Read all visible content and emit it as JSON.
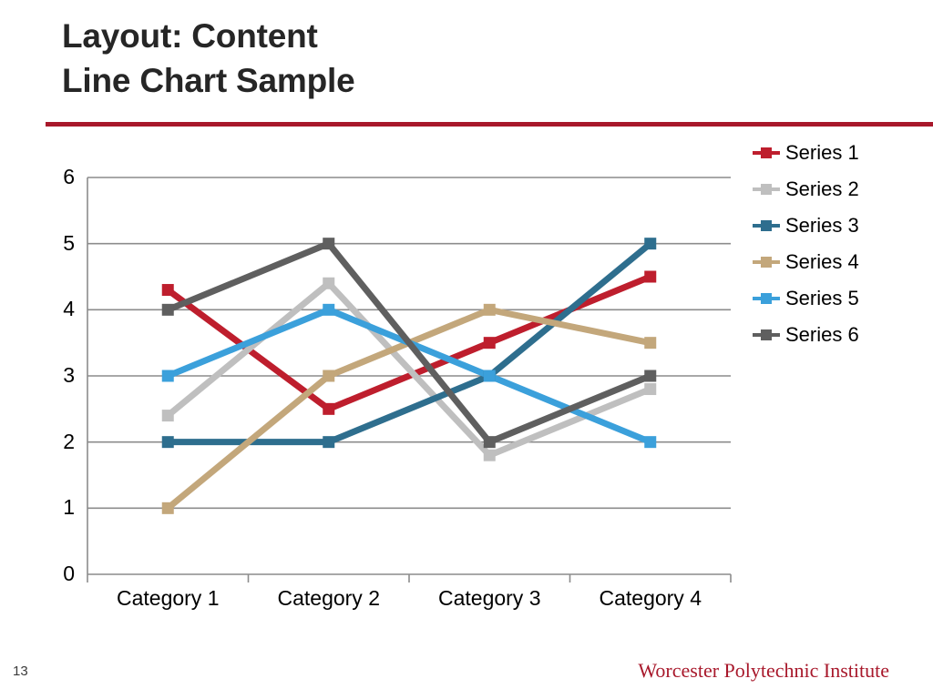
{
  "slide": {
    "title_line1": "Layout: Content",
    "title_line2": "Line Chart Sample",
    "rule_color": "#A8182B",
    "slide_number": "13",
    "footer_brand": "Worcester Polytechnic Institute"
  },
  "legend": {
    "position": "right",
    "items": [
      {
        "label": "Series 1",
        "color": "#BE1E2D"
      },
      {
        "label": "Series 2",
        "color": "#BFBFBF"
      },
      {
        "label": "Series 3",
        "color": "#2E6E8E"
      },
      {
        "label": "Series 4",
        "color": "#C3A77B"
      },
      {
        "label": "Series 5",
        "color": "#3BA0DB"
      },
      {
        "label": "Series 6",
        "color": "#5F5F5F"
      }
    ]
  },
  "chart_data": {
    "type": "line",
    "title": "Line Chart Sample",
    "xlabel": "",
    "ylabel": "",
    "categories": [
      "Category 1",
      "Category 2",
      "Category 3",
      "Category 4"
    ],
    "ylim": [
      0,
      6
    ],
    "yticks": [
      0,
      1,
      2,
      3,
      4,
      5,
      6
    ],
    "ytick_labels": [
      "0",
      "1",
      "2",
      "3",
      "4",
      "5",
      "6"
    ],
    "grid": "horizontal",
    "legend_position": "right",
    "markers": "square",
    "series": [
      {
        "name": "Series 1",
        "color": "#BE1E2D",
        "values": [
          4.3,
          2.5,
          3.5,
          4.5
        ]
      },
      {
        "name": "Series 2",
        "color": "#BFBFBF",
        "values": [
          2.4,
          4.4,
          1.8,
          2.8
        ]
      },
      {
        "name": "Series 3",
        "color": "#2E6E8E",
        "values": [
          2.0,
          2.0,
          3.0,
          5.0
        ]
      },
      {
        "name": "Series 4",
        "color": "#C3A77B",
        "values": [
          1.0,
          3.0,
          4.0,
          3.5
        ]
      },
      {
        "name": "Series 5",
        "color": "#3BA0DB",
        "values": [
          3.0,
          4.0,
          3.0,
          2.0
        ]
      },
      {
        "name": "Series 6",
        "color": "#5F5F5F",
        "values": [
          4.0,
          5.0,
          2.0,
          3.0
        ]
      }
    ]
  }
}
